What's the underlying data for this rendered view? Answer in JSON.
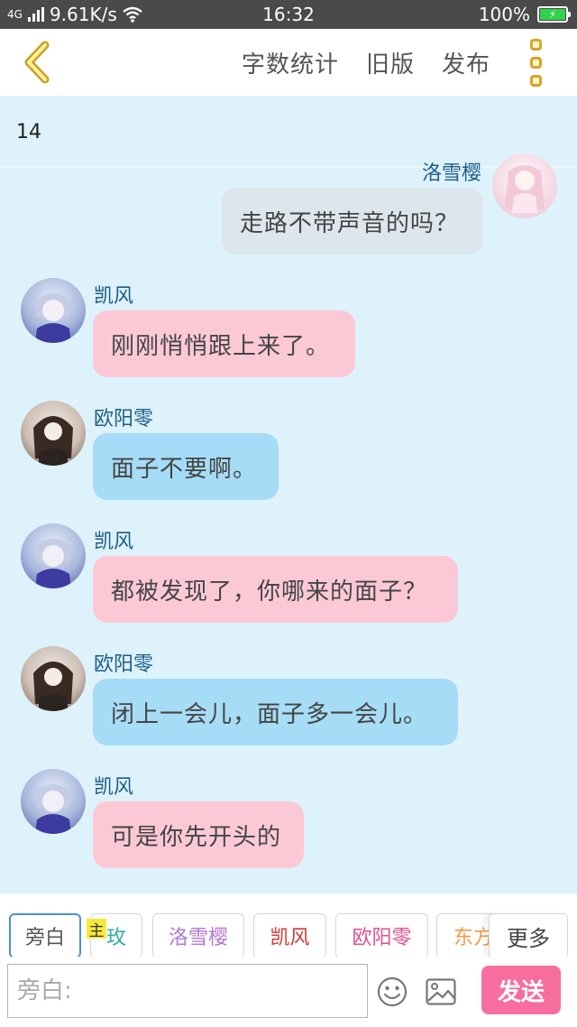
{
  "status_bar": {
    "network": "4G",
    "speed": "9.61K/s",
    "time": "16:32",
    "battery": "100%"
  },
  "top_bar": {
    "word_count": "字数统计",
    "old_version": "旧版",
    "publish": "发布"
  },
  "chat": {
    "count": "14",
    "partial_name": "洛雪樱",
    "messages": [
      {
        "speaker": "",
        "text": "走路不带声音的吗？"
      },
      {
        "speaker": "凯风",
        "text": "刚刚悄悄跟上来了。"
      },
      {
        "speaker": "欧阳零",
        "text": "面子不要啊。"
      },
      {
        "speaker": "凯风",
        "text": "都被发现了，你哪来的面子？"
      },
      {
        "speaker": "欧阳零",
        "text": "闭上一会儿，面子多一会儿。"
      },
      {
        "speaker": "凯风",
        "text": "可是你先开头的"
      }
    ]
  },
  "roles": {
    "main_tag": "主",
    "items": [
      {
        "label": "旁白",
        "color": "#555555"
      },
      {
        "label": "玫",
        "color": "#2fb0a0"
      },
      {
        "label": "洛雪樱",
        "color": "#b078d6"
      },
      {
        "label": "凯风",
        "color": "#d23a3a"
      },
      {
        "label": "欧阳零",
        "color": "#e0508c"
      },
      {
        "label": "东方",
        "color": "#f0a04a"
      }
    ],
    "more": "更多"
  },
  "input": {
    "placeholder": "旁白:",
    "send": "发送"
  },
  "colors": {
    "chat_bg": "#def2fb",
    "pink_bubble": "#fbc9d6",
    "blue_bubble": "#a6dcf6",
    "send_button": "#f76e9e"
  }
}
